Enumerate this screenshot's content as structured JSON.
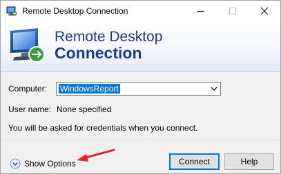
{
  "window": {
    "title": "Remote Desktop Connection"
  },
  "banner": {
    "line1": "Remote Desktop",
    "line2": "Connection"
  },
  "form": {
    "computer_label": "Computer:",
    "computer_value": "WindowsReport",
    "username_label": "User name:",
    "username_value": "None specified",
    "credentials_note": "You will be asked for credentials when you connect."
  },
  "footer": {
    "show_options_label": "Show Options",
    "connect_label": "Connect",
    "help_label": "Help"
  },
  "colors": {
    "banner_text": "#1e3b8c",
    "selection": "#0078d7",
    "annotation_arrow": "#e0262a"
  },
  "icons": [
    "rdc-app-icon",
    "rdc-logo-icon",
    "minimize-icon",
    "maximize-icon",
    "close-icon",
    "chevron-down-icon",
    "expand-options-icon",
    "annotation-arrow"
  ]
}
